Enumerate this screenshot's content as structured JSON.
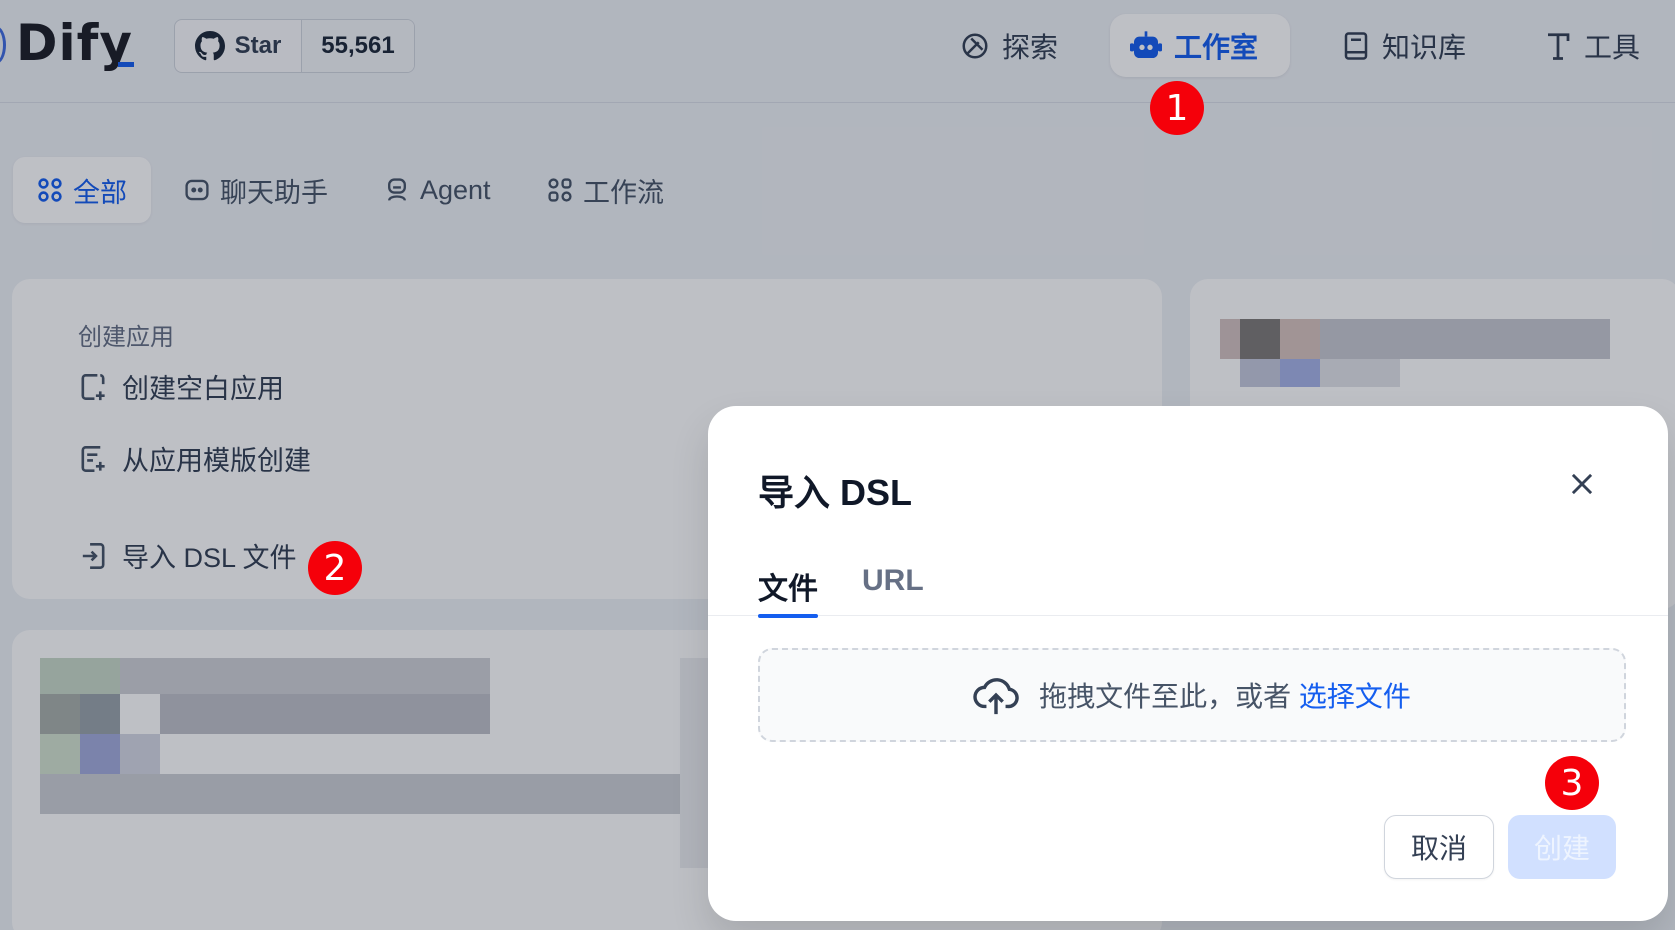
{
  "brand": {
    "name": "Dify"
  },
  "github": {
    "star_label": "Star",
    "count": "55,561"
  },
  "topnav": {
    "items": [
      {
        "label": "探索",
        "icon": "compass-icon",
        "active": false
      },
      {
        "label": "工作室",
        "icon": "robot-icon",
        "active": true
      },
      {
        "label": "知识库",
        "icon": "book-icon",
        "active": false
      },
      {
        "label": "工具",
        "icon": "hammer-icon",
        "active": false
      }
    ]
  },
  "category_tabs": [
    {
      "label": "全部",
      "icon": "grid-icon",
      "active": true
    },
    {
      "label": "聊天助手",
      "icon": "chat-icon",
      "active": false
    },
    {
      "label": "Agent",
      "icon": "agent-icon",
      "active": false
    },
    {
      "label": "工作流",
      "icon": "workflow-icon",
      "active": false
    }
  ],
  "create_panel": {
    "title": "创建应用",
    "items": [
      {
        "label": "创建空白应用",
        "icon": "new-file-icon"
      },
      {
        "label": "从应用模版创建",
        "icon": "template-icon"
      },
      {
        "label": "导入 DSL 文件",
        "icon": "import-icon"
      }
    ]
  },
  "modal": {
    "title": "导入 DSL",
    "tabs": [
      {
        "label": "文件",
        "active": true
      },
      {
        "label": "URL",
        "active": false
      }
    ],
    "dropzone": {
      "text": "拖拽文件至此，或者",
      "link": "选择文件"
    },
    "cancel_label": "取消",
    "create_label": "创建"
  },
  "steps": [
    "1",
    "2",
    "3"
  ],
  "colors": {
    "accent": "#155eef",
    "step_badge": "#f5000a",
    "disabled_button": "#d1e0ff"
  }
}
